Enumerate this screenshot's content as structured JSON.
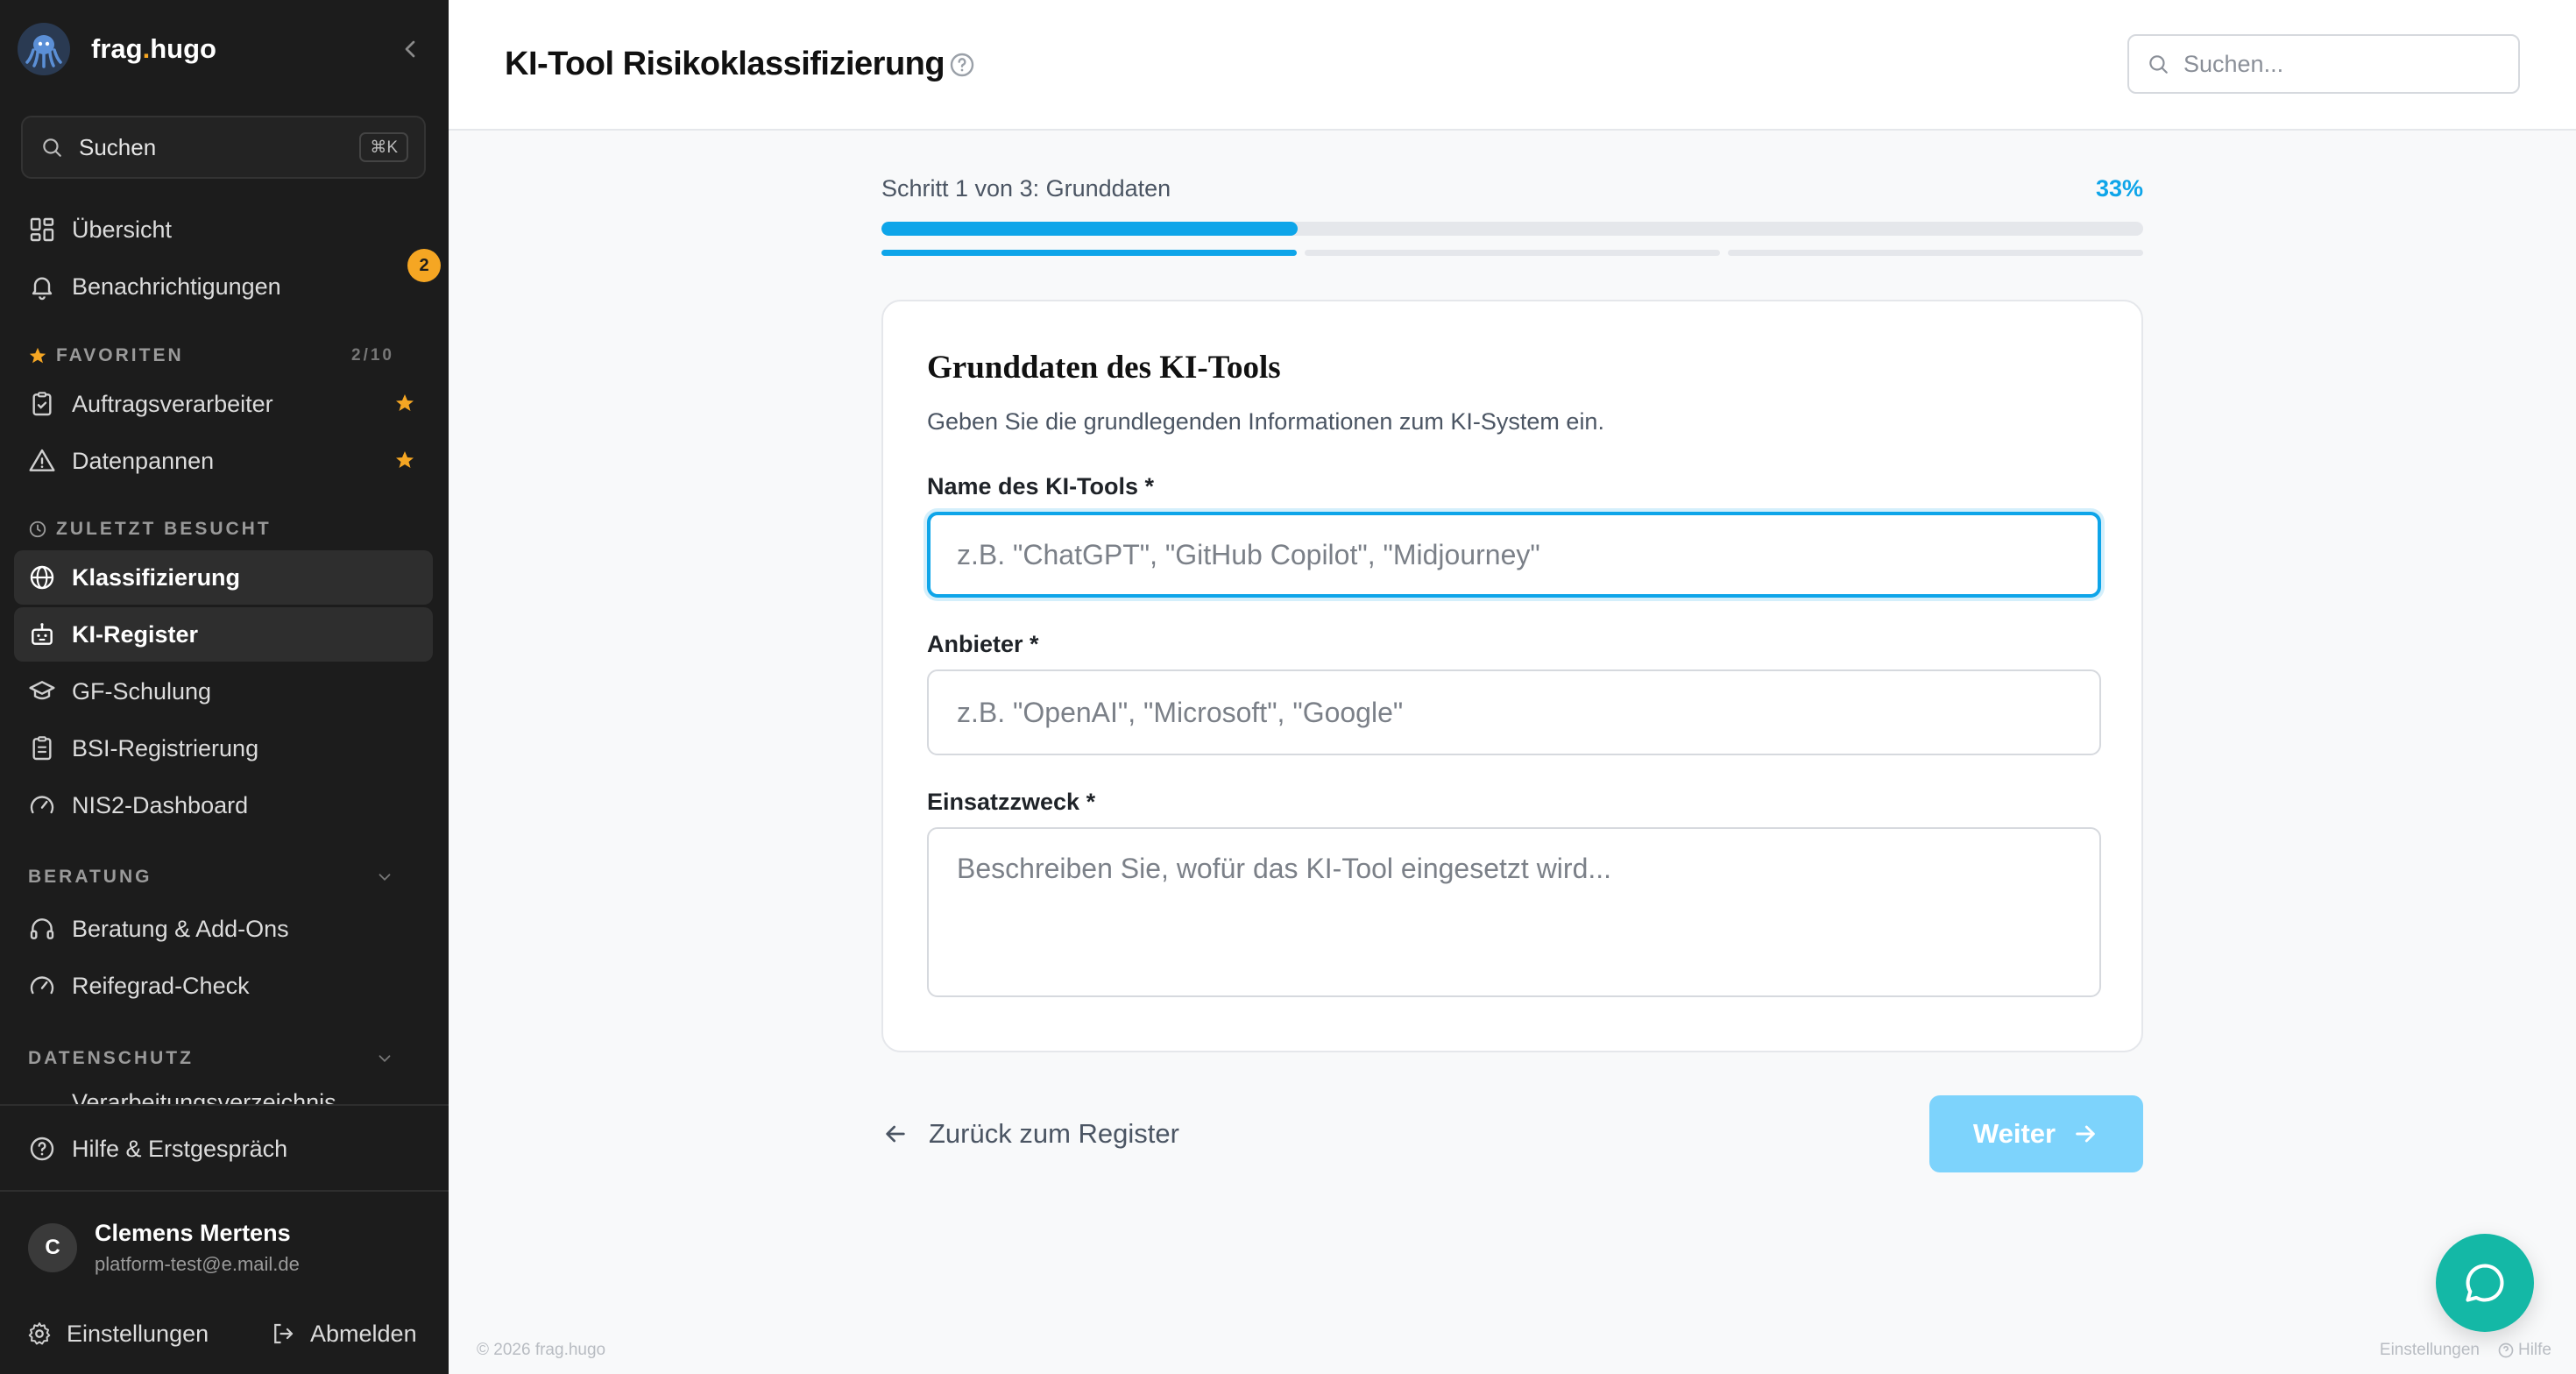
{
  "brand": {
    "name_prefix": "frag",
    "name_dot": ".",
    "name_suffix": "hugo"
  },
  "sidebar": {
    "search_label": "Suchen",
    "search_shortcut": "⌘K",
    "overview": "Übersicht",
    "notifications": "Benachrichtigungen",
    "notifications_badge": "2",
    "favorites_label": "FAVORITEN",
    "favorites_count": "2/10",
    "favorites": [
      "Auftragsverarbeiter",
      "Datenpannen"
    ],
    "recent_label": "ZULETZT BESUCHT",
    "recent": [
      "Klassifizierung",
      "KI-Register",
      "GF-Schulung",
      "BSI-Registrierung",
      "NIS2-Dashboard"
    ],
    "beratung_label": "BERATUNG",
    "beratung": [
      "Beratung & Add-Ons",
      "Reifegrad-Check"
    ],
    "datenschutz_label": "DATENSCHUTZ",
    "datenschutz_partial": "Verarbeitungsverzeichnis",
    "help": "Hilfe & Erstgespräch",
    "user": {
      "initial": "C",
      "name": "Clemens Mertens",
      "email": "platform-test@e.mail.de"
    },
    "settings": "Einstellungen",
    "logout": "Abmelden"
  },
  "header": {
    "title": "KI-Tool Risikoklassifizierung",
    "search_placeholder": "Suchen..."
  },
  "progress": {
    "step_label": "Schritt 1 von 3: Grunddaten",
    "percent_label": "33%",
    "fraction": 0.33,
    "steps_total": 3,
    "steps_done": 1
  },
  "form": {
    "title": "Grunddaten des KI-Tools",
    "subtitle": "Geben Sie die grundlegenden Informationen zum KI-System ein.",
    "name_label": "Name des KI-Tools *",
    "name_placeholder": "z.B. \"ChatGPT\", \"GitHub Copilot\", \"Midjourney\"",
    "provider_label": "Anbieter *",
    "provider_placeholder": "z.B. \"OpenAI\", \"Microsoft\", \"Google\"",
    "purpose_label": "Einsatzzweck *",
    "purpose_placeholder": "Beschreiben Sie, wofür das KI-Tool eingesetzt wird..."
  },
  "actions": {
    "back": "Zurück zum Register",
    "next": "Weiter"
  },
  "footer": {
    "copyright": "© 2026 frag.hugo",
    "settings": "Einstellungen",
    "help": "Hilfe"
  },
  "colors": {
    "accent": "#0ea5e9",
    "accent_light": "#7dd3fc",
    "sidebar_bg": "#1c1c1c",
    "badge": "#f5a623",
    "fab": "#14b8a6"
  }
}
